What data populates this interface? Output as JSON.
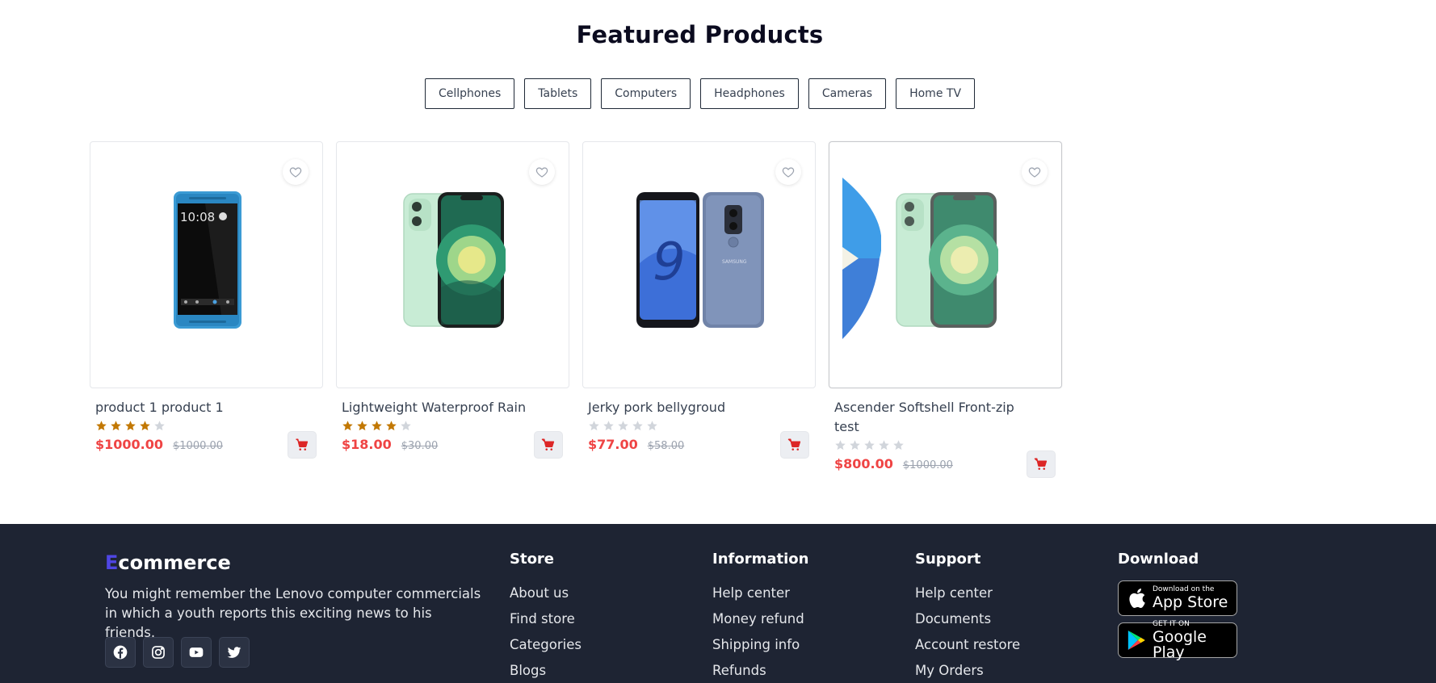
{
  "section": {
    "title": "Featured Products",
    "filters": [
      "Cellphones",
      "Tablets",
      "Computers",
      "Headphones",
      "Cameras",
      "Home TV"
    ]
  },
  "products": [
    {
      "name": "product 1 product 1",
      "rating": 4,
      "max_rating": 5,
      "price": "$1000.00",
      "old_price": "$1000.00",
      "image": "htc-phone"
    },
    {
      "name": "Lightweight Waterproof Rain",
      "rating": 4,
      "max_rating": 5,
      "price": "$18.00",
      "old_price": "$30.00",
      "image": "iphone-green"
    },
    {
      "name": "Jerky pork bellygroud",
      "rating": 0,
      "max_rating": 5,
      "price": "$77.00",
      "old_price": "$58.00",
      "image": "galaxy-s9"
    },
    {
      "name": "Ascender Softshell Front-zip test",
      "rating": 0,
      "max_rating": 5,
      "price": "$800.00",
      "old_price": "$1000.00",
      "image": "iphone-green"
    }
  ],
  "footer": {
    "brand_first_letter": "E",
    "brand_rest": "commerce",
    "description": "You might remember the Lenovo computer commercials in which a youth reports this exciting news to his friends.",
    "socials": [
      "facebook-icon",
      "instagram-icon",
      "youtube-icon",
      "twitter-icon"
    ],
    "columns": [
      {
        "title": "Store",
        "links": [
          "About us",
          "Find store",
          "Categories",
          "Blogs"
        ]
      },
      {
        "title": "Information",
        "links": [
          "Help center",
          "Money refund",
          "Shipping info",
          "Refunds"
        ]
      },
      {
        "title": "Support",
        "links": [
          "Help center",
          "Documents",
          "Account restore",
          "My Orders"
        ]
      }
    ],
    "download": {
      "title": "Download",
      "app_store": {
        "small": "Download on the",
        "big": "App Store"
      },
      "google_play": {
        "small": "GET IT ON",
        "big": "Google Play"
      }
    }
  },
  "colors": {
    "price": "#ef4444",
    "star_filled": "#c27803",
    "star_empty": "#d1d5db",
    "footer_bg": "#1e2433",
    "brand_accent": "#4f46e5",
    "cart_icon": "#dc2626"
  }
}
